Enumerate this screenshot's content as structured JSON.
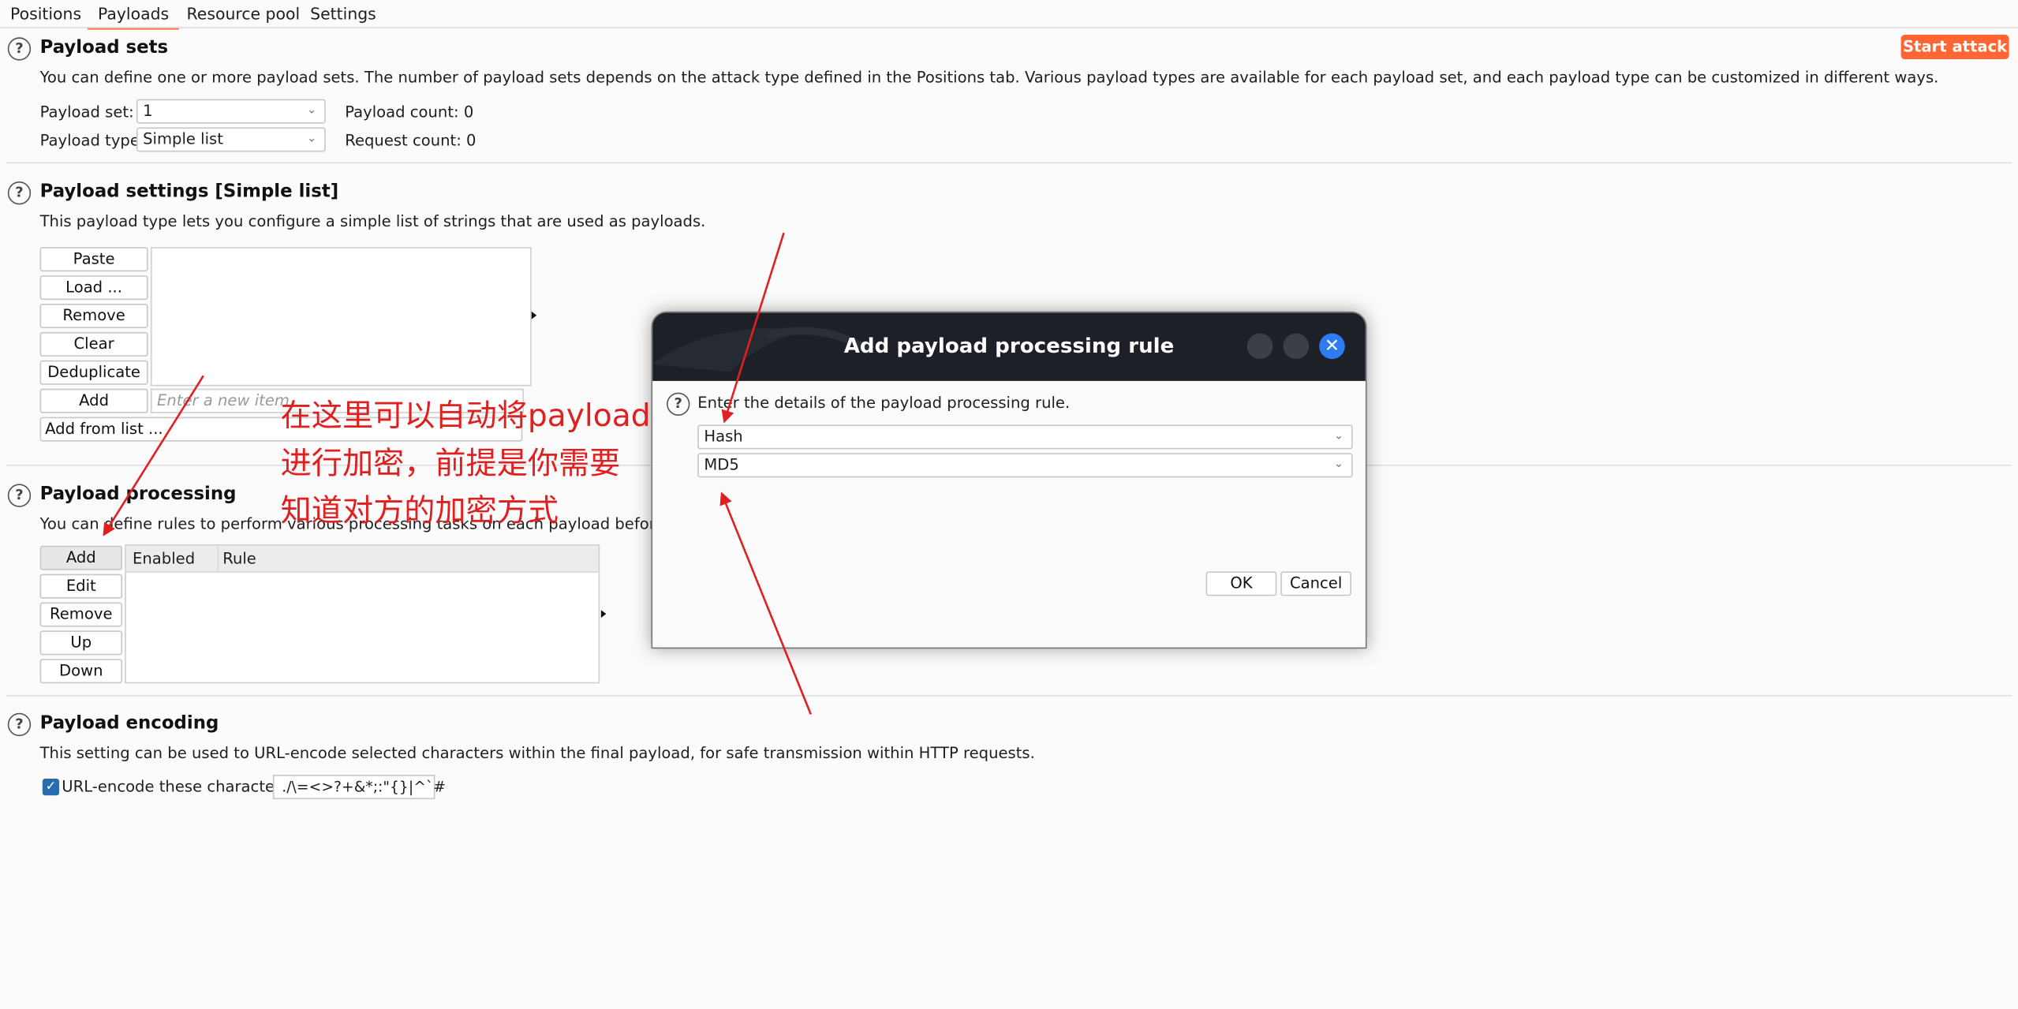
{
  "tabs": [
    "Positions",
    "Payloads",
    "Resource pool",
    "Settings"
  ],
  "start_attack": "Start attack",
  "payload_sets": {
    "title": "Payload sets",
    "description": "You can define one or more payload sets. The number of payload sets depends on the attack type defined in the Positions tab. Various payload types are available for each payload set, and each payload type can be customized in different ways.",
    "set_label": "Payload set:",
    "set_value": "1",
    "type_label": "Payload type:",
    "type_value": "Simple list",
    "count_label": "Payload count:",
    "count_value": "0",
    "request_label": "Request count:",
    "request_value": "0"
  },
  "payload_settings": {
    "title": "Payload settings [Simple list]",
    "description": "This payload type lets you configure a simple list of strings that are used as payloads.",
    "buttons": [
      "Paste",
      "Load ...",
      "Remove",
      "Clear",
      "Deduplicate"
    ],
    "add_label": "Add",
    "add_placeholder": "Enter a new item",
    "add_from_list": "Add from list ..."
  },
  "payload_processing": {
    "title": "Payload processing",
    "description": "You can define rules to perform various processing tasks on each payload before it is used.",
    "buttons": [
      "Add",
      "Edit",
      "Remove",
      "Up",
      "Down"
    ],
    "columns": [
      "Enabled",
      "Rule"
    ]
  },
  "payload_encoding": {
    "title": "Payload encoding",
    "description": "This setting can be used to URL-encode selected characters within the final payload, for safe transmission within HTTP requests.",
    "checkbox_label": "URL-encode these characters:",
    "characters": "./\\=<>?+&*;:\"{}|^`#",
    "checked": true
  },
  "dialog": {
    "title": "Add payload processing rule",
    "prompt": "Enter the details of the payload processing rule.",
    "rule_type": "Hash",
    "algorithm": "MD5",
    "ok": "OK",
    "cancel": "Cancel"
  },
  "annotation": {
    "lines": [
      "在这里可以自动将payload",
      "进行加密，前提是你需要",
      "知道对方的加密方式"
    ],
    "color": "#e02020"
  },
  "colors": {
    "accent": "#ff6633",
    "dialog_title_bg": "#1d2027",
    "close_button": "#2d7cf2"
  }
}
